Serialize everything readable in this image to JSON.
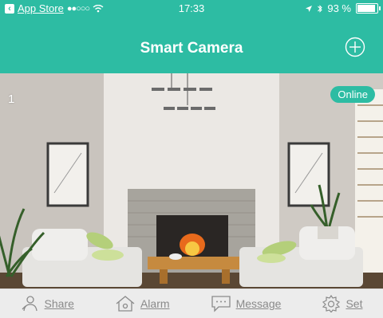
{
  "status_bar": {
    "carrier": "App Store",
    "signal": "●●○○○",
    "time": "17:33",
    "battery": "93 %",
    "battery_level": 0.93
  },
  "nav": {
    "title": "Smart Camera"
  },
  "camera": {
    "number": "1",
    "status": "Online"
  },
  "tabs": [
    {
      "label": "Share",
      "icon": "share-icon"
    },
    {
      "label": "Alarm",
      "icon": "alarm-icon"
    },
    {
      "label": "Message",
      "icon": "message-icon"
    },
    {
      "label": "Set",
      "icon": "gear-icon"
    }
  ],
  "colors": {
    "accent": "#2dbca3",
    "tab_bar": "#ececec"
  }
}
